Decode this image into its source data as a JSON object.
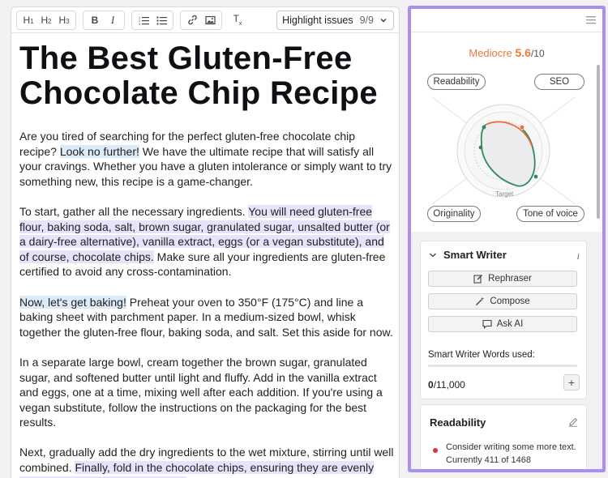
{
  "toolbar": {
    "h1": "H",
    "h1_sub": "1",
    "h2": "H",
    "h2_sub": "2",
    "h3": "H",
    "h3_sub": "3",
    "bold": "B",
    "italic": "I",
    "clear_format": "T",
    "highlight_label": "Highlight issues",
    "highlight_count": "9/9"
  },
  "document": {
    "title": "The Best Gluten-Free Chocolate Chip Recipe",
    "p1": {
      "a": "Are you tired of searching for the perfect gluten-free chocolate chip recipe? ",
      "b": "Look no further!",
      "c": " We have the ultimate recipe that will satisfy all your cravings. Whether you have a gluten intolerance or simply want to try something new, this recipe is a game-changer."
    },
    "p2": {
      "a": "To start, gather all the necessary ingredients. ",
      "b": "You will need gluten-free flour, baking soda, salt, brown sugar, granulated sugar, unsalted butter (or a dairy-free alternative), vanilla extract, eggs (or a vegan substitute), and of course, chocolate chips.",
      "c": " Make sure all your ingredients are gluten-free certified to avoid any cross-contamination."
    },
    "p3": {
      "a": "Now, let's get baking!",
      "b": " Preheat your oven to 350°F (175°C) and line a baking sheet with parchment paper. In a medium-sized bowl, whisk together the gluten-free flour, baking soda, and salt. Set this aside for now."
    },
    "p4": "In a separate large bowl, cream together the brown sugar, granulated sugar, and softened butter until light and fluffy. Add in the vanilla extract and eggs, one at a time, mixing well after each addition. If you're using a vegan substitute, follow the instructions on the packaging for the best results.",
    "p5": {
      "a": "Next, gradually add the dry ingredients to the wet mixture, stirring until well combined. ",
      "b": "Finally, fold in the chocolate chips, ensuring they are evenly distributed throughout the dough."
    }
  },
  "score": {
    "label": "Mediocre",
    "value": "5.6",
    "max": "/10",
    "fill_fraction": 0.56,
    "colors": {
      "score": "#e97a3e",
      "arc_orange": "#e8703a",
      "arc_green": "#2e8b5e",
      "accent_border": "#a98ff0"
    }
  },
  "metrics": {
    "readability": "Readability",
    "seo": "SEO",
    "originality": "Originality",
    "tone": "Tone of voice",
    "target": "Target"
  },
  "smart_writer": {
    "title": "Smart Writer",
    "info": "i",
    "rephraser": "Rephraser",
    "compose": "Compose",
    "ask_ai": "Ask AI",
    "words_label": "Smart Writer Words used:",
    "words_used": "0",
    "words_total": "/11,000",
    "add": "+"
  },
  "readability_card": {
    "title": "Readability",
    "issue": "Consider writing some more text. Currently 411 of 1468"
  }
}
